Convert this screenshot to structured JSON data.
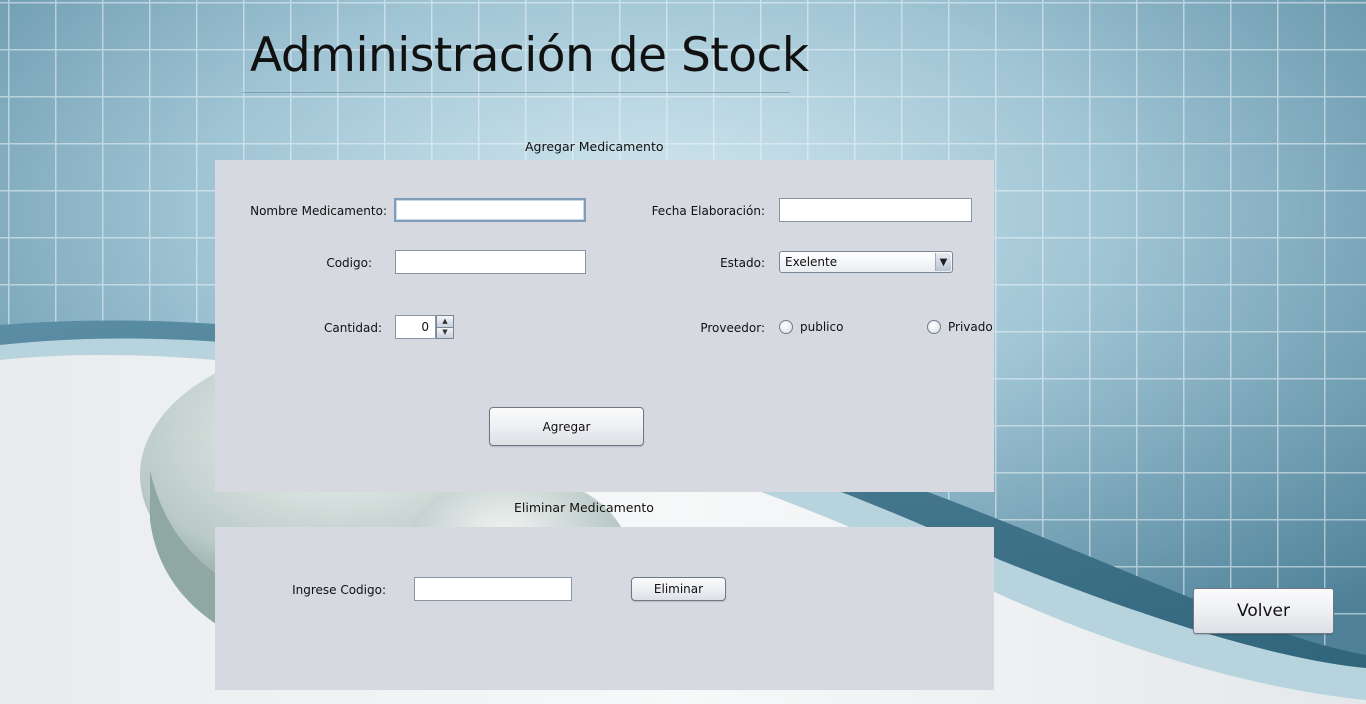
{
  "window": {
    "title": "Administración de Stock"
  },
  "add_section": {
    "heading": "Agregar Medicamento",
    "nombre_label": "Nombre Medicamento:",
    "nombre_value": "",
    "codigo_label": "Codigo:",
    "codigo_value": "",
    "cantidad_label": "Cantidad:",
    "cantidad_value": "0",
    "fecha_label": "Fecha Elaboración:",
    "fecha_value": "",
    "estado_label": "Estado:",
    "estado_selected": "Exelente",
    "proveedor_label": "Proveedor:",
    "proveedor_options": [
      "publico",
      "Privado"
    ],
    "agregar_label": "Agregar"
  },
  "delete_section": {
    "heading": "Eliminar Medicamento",
    "codigo_label": "Ingrese Codigo:",
    "codigo_value": "",
    "eliminar_label": "Eliminar"
  },
  "volver_label": "Volver",
  "icons": {
    "combo_arrow": "chevron-down-icon",
    "spin_up": "chevron-up-icon",
    "spin_down": "chevron-down-icon"
  },
  "colors": {
    "panel": "#d6d9e0",
    "background_blue": "#6e9db3",
    "background_light": "#c4dbe6"
  }
}
